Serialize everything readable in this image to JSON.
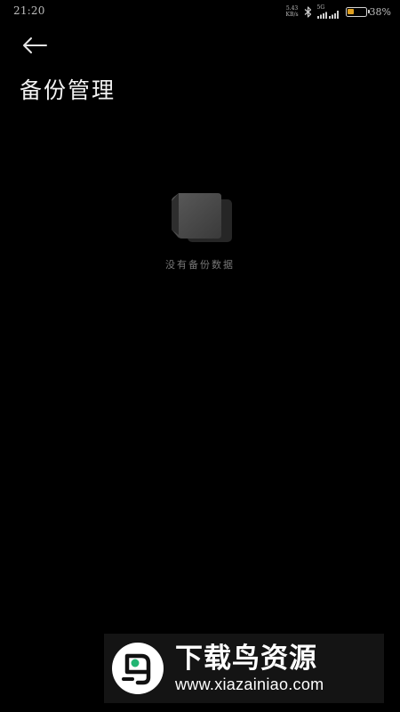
{
  "status_bar": {
    "time": "21:20",
    "net_speed_value": "5.43",
    "net_speed_unit": "KB/s",
    "network_type": "5G",
    "battery_percent": "38%",
    "battery_level": 0.38,
    "battery_color": "#e0a020"
  },
  "header": {
    "back_icon": "arrow-left-icon",
    "title": "备份管理"
  },
  "empty_state": {
    "icon": "empty-box-icon",
    "message": "没有备份数据"
  },
  "watermark": {
    "name": "下载鸟资源",
    "url": "www.xiazainiao.com",
    "accent_color": "#22b573"
  }
}
